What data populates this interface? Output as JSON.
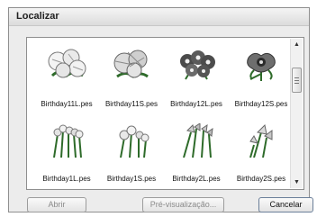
{
  "window": {
    "title": "Localizar"
  },
  "files": [
    {
      "name": "Birthday11L.pes",
      "icon": "chrysanthemum-large-thumbnail"
    },
    {
      "name": "Birthday11S.pes",
      "icon": "chrysanthemum-small-thumbnail"
    },
    {
      "name": "Birthday12L.pes",
      "icon": "pansy-large-thumbnail"
    },
    {
      "name": "Birthday12S.pes",
      "icon": "pansy-small-thumbnail"
    },
    {
      "name": "Birthday1L.pes",
      "icon": "daffodil-large-thumbnail"
    },
    {
      "name": "Birthday1S.pes",
      "icon": "daffodil-small-thumbnail"
    },
    {
      "name": "Birthday2L.pes",
      "icon": "iris-large-thumbnail"
    },
    {
      "name": "Birthday2S.pes",
      "icon": "iris-small-thumbnail"
    }
  ],
  "buttons": {
    "open": "Abrir",
    "preview": "Pré-visualização...",
    "cancel": "Cancelar"
  }
}
